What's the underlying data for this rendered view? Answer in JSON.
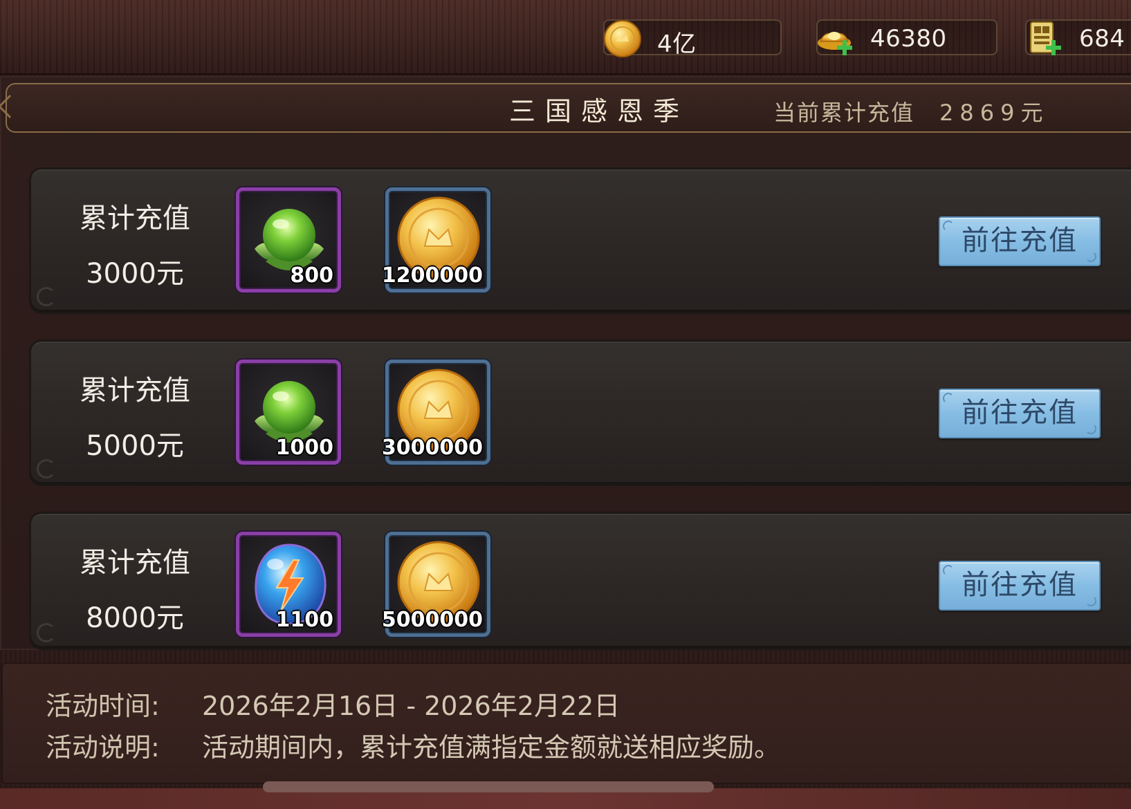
{
  "currency": {
    "gold": "4亿",
    "ingot": "46380",
    "ticket": "684",
    "icons": [
      "gold-coin-icon",
      "ingot-plus-icon",
      "scroll-ticket-plus-icon"
    ]
  },
  "header": {
    "title": "三国感恩季",
    "total_label": "当前累计充值",
    "total_value": "2869元"
  },
  "rows": [
    {
      "label": "累计充值",
      "amount": "3000元",
      "items": [
        {
          "icon": "green-seed-icon",
          "qty": "800",
          "frame": "purple"
        },
        {
          "icon": "gold-coin-icon",
          "qty": "1200000",
          "frame": "blue"
        }
      ],
      "button": "前往充值"
    },
    {
      "label": "累计充值",
      "amount": "5000元",
      "items": [
        {
          "icon": "green-seed-icon",
          "qty": "1000",
          "frame": "purple"
        },
        {
          "icon": "gold-coin-icon",
          "qty": "3000000",
          "frame": "blue"
        }
      ],
      "button": "前往充值"
    },
    {
      "label": "累计充值",
      "amount": "8000元",
      "items": [
        {
          "icon": "blue-lightning-gem-icon",
          "qty": "1100",
          "frame": "purple"
        },
        {
          "icon": "gold-coin-icon",
          "qty": "5000000",
          "frame": "blue"
        }
      ],
      "button": "前往充值"
    }
  ],
  "info": {
    "time_label": "活动时间:",
    "time_value": "2026年2月16日 - 2026年2月22日",
    "desc_label": "活动说明:",
    "desc_value": "活动期间内，累计充值满指定金额就送相应奖励。"
  },
  "colors": {
    "background": "#2a1917",
    "row_bg": "#2c2725",
    "purple_frame": "#8a3fa6",
    "blue_frame": "#4f6f93",
    "button": "#86bde4",
    "button_text": "#2e4968",
    "title_text": "#f3ead5",
    "muted_text": "#c7b89b"
  }
}
